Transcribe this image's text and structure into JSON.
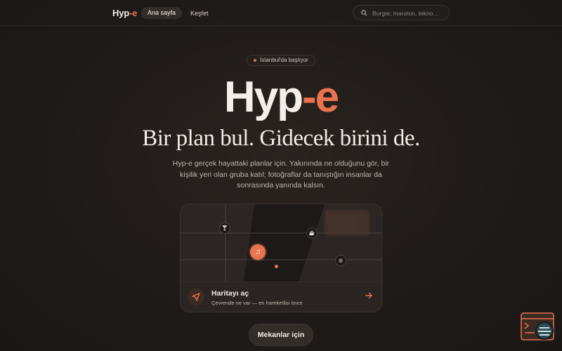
{
  "nav": {
    "logo_main": "Hyp",
    "logo_accent": "-e",
    "tabs": [
      {
        "label": "Ana sayfa",
        "active": true
      },
      {
        "label": "Keşfet",
        "active": false
      }
    ],
    "search_placeholder": "Burger, maraton, tekno..."
  },
  "hero": {
    "pill": "İstanbul'da başlıyor",
    "title_main": "Hyp",
    "title_accent": "-e",
    "tagline": "Bir plan bul. Gidecek birini de.",
    "description": "Hyp-e gerçek hayattaki planlar için. Yakınında ne olduğunu gör, bir kişilik yeri olan gruba katıl; fotoğraflar da tanıştığın insanlar da sonrasında yanında kalsın."
  },
  "map_card": {
    "title": "Haritayı aç",
    "subtitle": "Çevrende ne var — en hareketlisi önce",
    "markers": [
      "cocktail-icon",
      "coffee-icon",
      "music-icon",
      "basketball-icon"
    ]
  },
  "cta": {
    "label": "Mekanlar için"
  },
  "colors": {
    "accent": "#e8734e",
    "background": "#1f1b19",
    "text": "#ece6e1"
  }
}
